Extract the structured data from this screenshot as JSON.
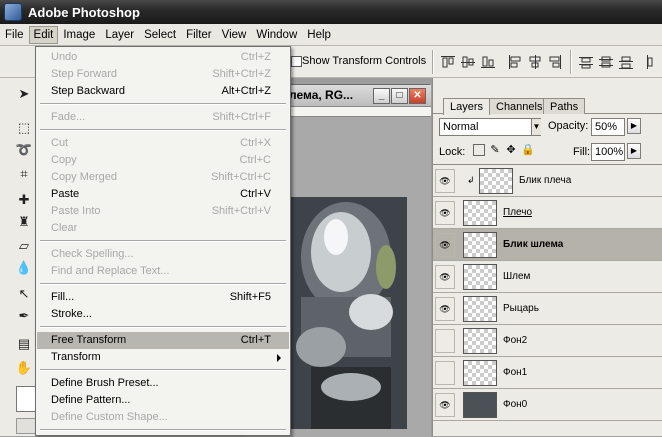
{
  "window": {
    "title": "Adobe Photoshop"
  },
  "menubar": [
    "File",
    "Edit",
    "Image",
    "Layer",
    "Select",
    "Filter",
    "View",
    "Window",
    "Help"
  ],
  "options": {
    "show_transform_controls": "Show Transform Controls",
    "checked": false
  },
  "document": {
    "title": "лема, RG..."
  },
  "edit_menu": [
    {
      "label": "Undo",
      "shortcut": "Ctrl+Z",
      "enabled": false
    },
    {
      "label": "Step Forward",
      "shortcut": "Shift+Ctrl+Z",
      "enabled": false
    },
    {
      "label": "Step Backward",
      "shortcut": "Alt+Ctrl+Z",
      "enabled": true
    },
    {
      "label": "Fade...",
      "shortcut": "Shift+Ctrl+F",
      "enabled": false
    },
    {
      "label": "Cut",
      "shortcut": "Ctrl+X",
      "enabled": false
    },
    {
      "label": "Copy",
      "shortcut": "Ctrl+C",
      "enabled": false
    },
    {
      "label": "Copy Merged",
      "shortcut": "Shift+Ctrl+C",
      "enabled": false
    },
    {
      "label": "Paste",
      "shortcut": "Ctrl+V",
      "enabled": true
    },
    {
      "label": "Paste Into",
      "shortcut": "Shift+Ctrl+V",
      "enabled": false
    },
    {
      "label": "Clear",
      "shortcut": "",
      "enabled": false
    },
    {
      "label": "Check Spelling...",
      "shortcut": "",
      "enabled": false
    },
    {
      "label": "Find and Replace Text...",
      "shortcut": "",
      "enabled": false
    },
    {
      "label": "Fill...",
      "shortcut": "Shift+F5",
      "enabled": true
    },
    {
      "label": "Stroke...",
      "shortcut": "",
      "enabled": true
    },
    {
      "label": "Free Transform",
      "shortcut": "Ctrl+T",
      "enabled": true,
      "highlighted": true
    },
    {
      "label": "Transform",
      "shortcut": "",
      "enabled": true,
      "submenu": true
    },
    {
      "label": "Define Brush Preset...",
      "shortcut": "",
      "enabled": true
    },
    {
      "label": "Define Pattern...",
      "shortcut": "",
      "enabled": true
    },
    {
      "label": "Define Custom Shape...",
      "shortcut": "",
      "enabled": false
    }
  ],
  "layers_panel": {
    "tabs": [
      "Layers",
      "Channels",
      "Paths"
    ],
    "active_tab": "Layers",
    "blend_mode": "Normal",
    "opacity_label": "Opacity:",
    "opacity": "50%",
    "lock_label": "Lock:",
    "fill_label": "Fill:",
    "fill": "100%",
    "layers": [
      {
        "name": "Блик плеча",
        "visible": true,
        "linked": true,
        "thumb": "transparent"
      },
      {
        "name": "Плечо",
        "visible": true,
        "underlined": true,
        "thumb": "transparent"
      },
      {
        "name": "Блик шлема",
        "visible": true,
        "selected": true,
        "thumb": "transparent"
      },
      {
        "name": "Шлем",
        "visible": true,
        "thumb": "transparent"
      },
      {
        "name": "Рыцарь",
        "visible": true,
        "thumb": "transparent"
      },
      {
        "name": "Фон2",
        "visible": false,
        "thumb": "transparent"
      },
      {
        "name": "Фон1",
        "visible": false,
        "thumb": "transparent"
      },
      {
        "name": "Фон0",
        "visible": true,
        "thumb": "dark"
      }
    ]
  },
  "colors": {
    "highlight": "#b7b6b0",
    "disabled": "#a8a8a8",
    "titlebar": "#2a2a2a"
  }
}
